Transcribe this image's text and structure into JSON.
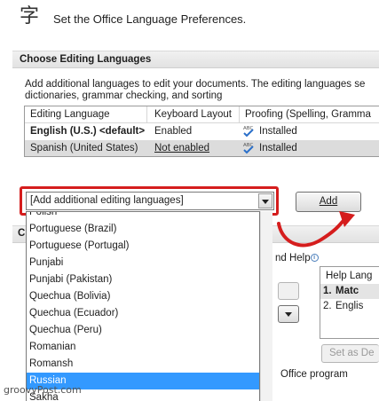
{
  "header": {
    "icon_glyph": "字",
    "title": "Set the Office Language Preferences."
  },
  "editing_section": {
    "title": "Choose Editing Languages",
    "description": "Add additional languages to edit your documents. The editing languages se dictionaries, grammar checking, and sorting",
    "columns": [
      "Editing Language",
      "Keyboard Layout",
      "Proofing (Spelling, Gramma"
    ],
    "rows": [
      {
        "language": "English (U.S.) <default>",
        "keyboard": "Enabled",
        "proofing": "Installed"
      },
      {
        "language": "Spanish (United States)",
        "keyboard": "Not enabled",
        "proofing": "Installed"
      }
    ],
    "combo_value": "[Add additional editing languages]",
    "add_button": "Add"
  },
  "dropdown": {
    "items": [
      "Polish",
      "Portuguese (Brazil)",
      "Portuguese (Portugal)",
      "Punjabi",
      "Punjabi (Pakistan)",
      "Quechua (Bolivia)",
      "Quechua (Ecuador)",
      "Quechua (Peru)",
      "Romanian",
      "Romansh",
      "Russian",
      "Sakha"
    ],
    "selected_index": 10
  },
  "background": {
    "section_letter": "C",
    "help_label": "nd Help",
    "help_box": {
      "header": "Help Lang",
      "item1_num": "1.",
      "item1": "Matc",
      "item2_num": "2.",
      "item2": "Englis"
    },
    "set_default_button": "Set as De",
    "office_program": "Office program"
  },
  "watermark": "groovyPost.com",
  "colors": {
    "highlight": "#3399ff",
    "annotation_red": "#d51d1d"
  }
}
